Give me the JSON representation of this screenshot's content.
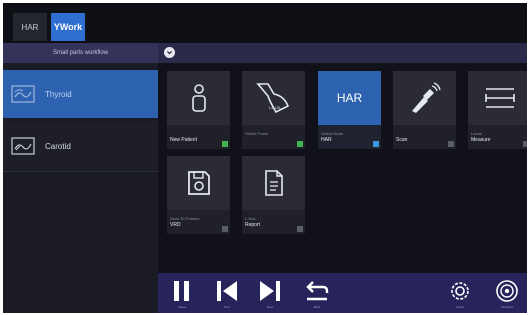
{
  "tabs": [
    {
      "label": "HAR"
    },
    {
      "label": "YWork"
    }
  ],
  "workflow": {
    "title": "Small parts workflow"
  },
  "left_list": [
    {
      "label": "Thyroid",
      "icon": "thyroid-image-icon",
      "selected": true
    },
    {
      "label": "Carotid",
      "icon": "carotid-image-icon",
      "selected": false
    }
  ],
  "tiles": [
    {
      "small": "",
      "label": "New Patient",
      "icon": "person-icon",
      "status": "green"
    },
    {
      "small": "Select Probe",
      "label": "",
      "probe_tag": "L4-15L",
      "icon": "probe-icon",
      "status": "green"
    },
    {
      "small": "Select Mode",
      "label": "HAR",
      "icon_text": "HAR",
      "icon": "har-icon",
      "status": "blue"
    },
    {
      "small": "",
      "label": "Scan",
      "icon": "scan-probe-icon",
      "status": "gray"
    },
    {
      "small": "Linear",
      "label": "Measure",
      "icon": "measure-icon",
      "status": "gray"
    },
    {
      "small": "Save 30 Frames",
      "label": "VRD",
      "icon": "save-icon",
      "status": "gray"
    },
    {
      "small": "L-Nav",
      "label": "Report",
      "icon": "report-icon",
      "status": "gray"
    }
  ],
  "controls": [
    {
      "label": "Pause",
      "icon": "pause-icon"
    },
    {
      "label": "Prev",
      "icon": "previous-icon"
    },
    {
      "label": "Next",
      "icon": "next-icon"
    },
    {
      "label": "Back",
      "icon": "back-arrow-icon"
    },
    {
      "label": "Setup",
      "icon": "gear-icon"
    },
    {
      "label": "Workflow",
      "icon": "workflow-icon"
    }
  ],
  "colors": {
    "accent": "#2f6fd0",
    "selected_item": "#2d62b0",
    "control_bar": "#26245a",
    "status_green": "#3fb34f",
    "status_blue": "#3a9ad8"
  }
}
